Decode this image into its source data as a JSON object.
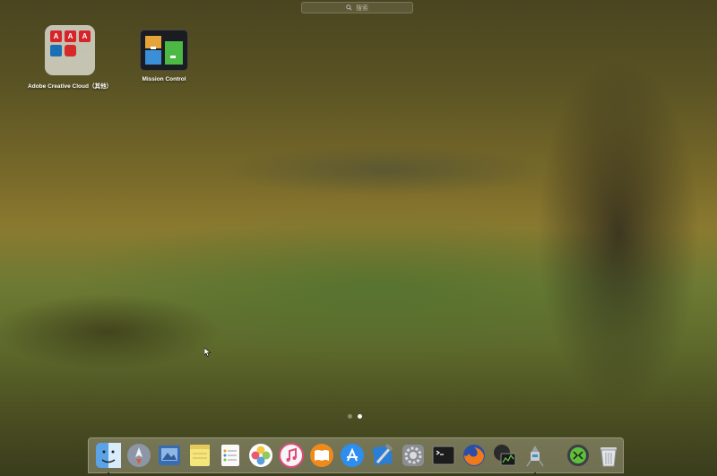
{
  "search": {
    "placeholder": "搜索"
  },
  "apps": [
    {
      "label": "Adobe Creative Cloud（其他）"
    },
    {
      "label": "Mission Control"
    }
  ],
  "folder_icons": [
    "adobe-acrobat-icon",
    "adobe-acrobat-icon",
    "adobe-acrobat-icon",
    "adobe-application-manager-icon",
    "creative-cloud-icon"
  ],
  "page_indicator": {
    "pages": 2,
    "current": 2
  },
  "dock": {
    "items": [
      "finder-icon",
      "launchpad-icon",
      "preview-icon",
      "notes-icon",
      "reminders-icon",
      "photos-icon",
      "itunes-icon",
      "ibooks-icon",
      "app-store-icon",
      "xcode-icon",
      "system-preferences-icon",
      "terminal-icon",
      "firefox-icon",
      "activity-monitor-icon",
      "automator-icon"
    ],
    "right_items": [
      "disk-utility-icon",
      "trash-icon"
    ]
  },
  "colors": {
    "wallpaper": "#7a6b2a",
    "adobe_red": "#d7242a"
  }
}
